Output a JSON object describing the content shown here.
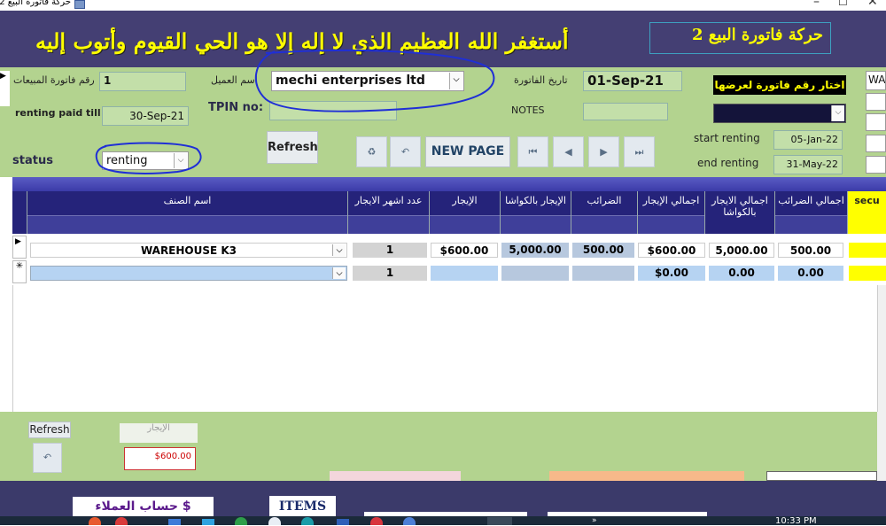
{
  "window": {
    "title": "حركة فاتورة البيع 2",
    "min": "–",
    "max": "☐",
    "close": "✕"
  },
  "header": {
    "banner_text": "أستغفر الله العظيم الذي لا إله إلا هو الحي القيوم وأتوب إليه",
    "form_title": "حركة فاتورة البيع 2"
  },
  "form": {
    "invoice_no_label": "رقم فاتورة المبيعات",
    "invoice_no": "1",
    "customer_label": "اسم العميل",
    "customer": "mechi enterprises ltd",
    "invoice_date_label": "تاريخ الفاتورة",
    "invoice_date": "01-Sep-21",
    "choose_invoice_label": "اختار رقم فاتورة لعرضها",
    "right_partial": "WA",
    "renting_paid_till_label": "renting paid till",
    "renting_paid_till": "30-Sep-21",
    "tpin_label": "TPIN no:",
    "tpin": "",
    "notes_label": "NOTES",
    "notes": "",
    "refresh_label": "Refresh",
    "new_page_label": "NEW PAGE",
    "status_label": "status",
    "status": "renting",
    "start_renting_label": "start renting",
    "start_renting": "05-Jan-22",
    "end_renting_label": "end renting",
    "end_renting": "31-May-22"
  },
  "grid": {
    "headers": {
      "item": "اسم الصنف",
      "months": "عدد اشهر الايجار",
      "rent": "الإيجار",
      "rent_kwacha": "الإيجار بالكواشا",
      "taxes": "الضرائب",
      "total_rent": "اجمالي الإيجار",
      "total_rent_kwacha": "اجمالي الايجار بالكواشا",
      "total_taxes": "اجمالي الضرائب",
      "security": "secu"
    },
    "rows": [
      {
        "item": "WAREHOUSE K3",
        "months": "1",
        "rent": "$600.00",
        "rent_kwacha": "5,000.00",
        "taxes": "500.00",
        "total_rent": "$600.00",
        "total_rent_kwacha": "5,000.00",
        "total_taxes": "500.00"
      },
      {
        "item": "",
        "months": "1",
        "rent": "",
        "rent_kwacha": "",
        "taxes": "",
        "total_rent": "$0.00",
        "total_rent_kwacha": "0.00",
        "total_taxes": "0.00"
      }
    ],
    "new_row_marker": "✳",
    "current_row_marker": "▶"
  },
  "footer": {
    "refresh_label": "Refresh",
    "rent_caption": "الإيجار",
    "rent_total": "$600.00"
  },
  "bottom": {
    "customer_account_label": "حساب العملاء $",
    "items_label": "ITEMS",
    "clock": "10:33 PM"
  }
}
